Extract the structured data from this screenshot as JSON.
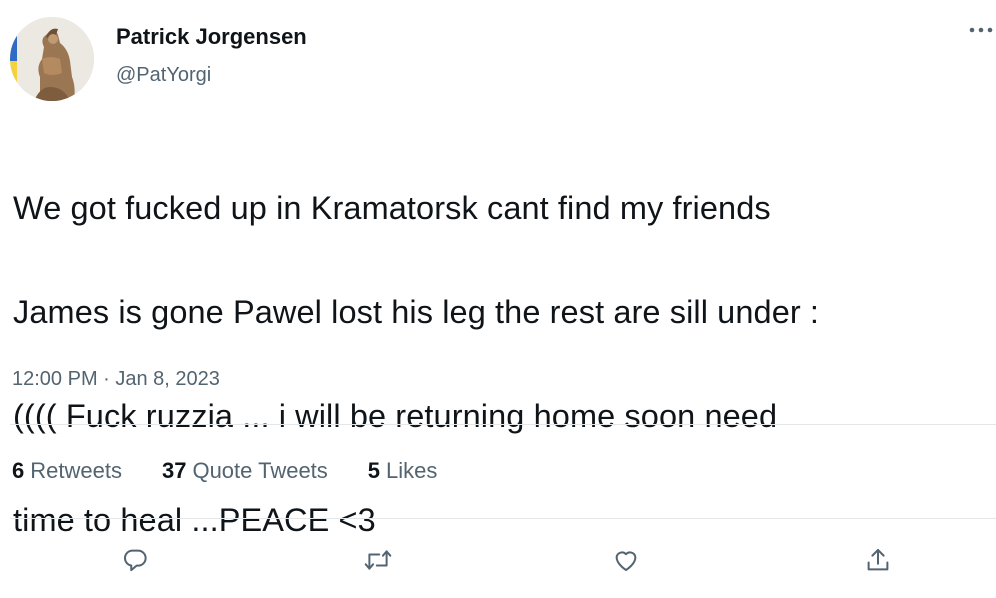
{
  "author": {
    "display_name": "Patrick Jorgensen",
    "handle": "@PatYorgi",
    "avatar_icon": "user-avatar"
  },
  "tweet": {
    "text_lines": [
      "We got fucked up in Kramatorsk cant find my friends",
      "James is gone Pawel lost his leg the rest are sill under :",
      "(((( Fuck ruzzia ... i will be returning home soon need",
      "time to heal ...PEACE <3"
    ],
    "timestamp": "12:00 PM · Jan 8, 2023"
  },
  "stats": {
    "retweets": {
      "count": "6",
      "label": "Retweets"
    },
    "quote_tweets": {
      "count": "37",
      "label": "Quote Tweets"
    },
    "likes": {
      "count": "5",
      "label": "Likes"
    }
  },
  "actions": {
    "reply_icon": "reply-icon",
    "retweet_icon": "retweet-icon",
    "like_icon": "heart-icon",
    "share_icon": "share-icon",
    "more_icon": "more-icon"
  },
  "colors": {
    "text": "#0f1419",
    "secondary": "#536471",
    "divider": "#e3e7ea",
    "background": "#ffffff"
  }
}
